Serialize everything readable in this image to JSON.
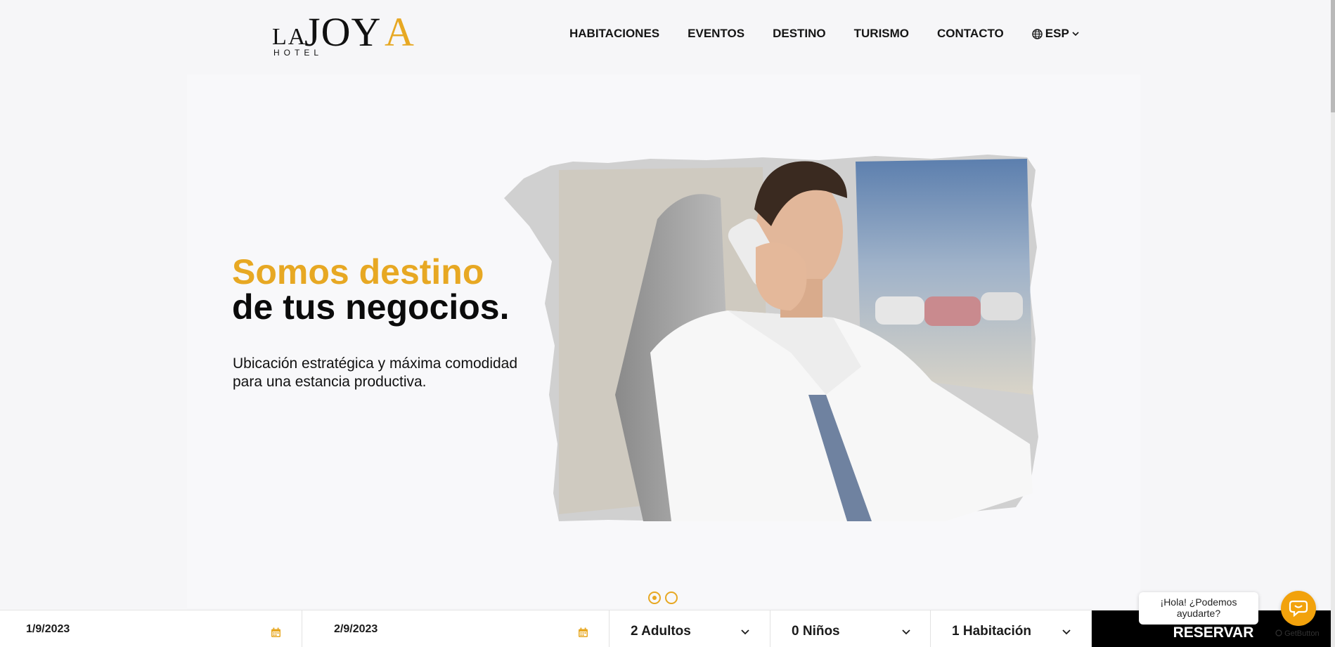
{
  "brand": {
    "logo_la": "LA",
    "logo_joy": "JOY",
    "logo_a": "A",
    "logo_hotel": "HOTEL",
    "accent_color": "#e7a823"
  },
  "nav": {
    "items": [
      "HABITACIONES",
      "EVENTOS",
      "DESTINO",
      "TURISMO",
      "CONTACTO"
    ],
    "language": "ESP",
    "language_icon": "globe-icon"
  },
  "hero": {
    "title_line1": "Somos destino",
    "title_line2": "de tus negocios.",
    "subtitle": "Ubicación estratégica y máxima comodidad para una estancia productiva.",
    "slides": 2,
    "active_slide": 1
  },
  "booking": {
    "checkin": "1/9/2023",
    "checkout": "2/9/2023",
    "adults": "2 Adultos",
    "children": "0 Niños",
    "rooms": "1 Habitación",
    "submit": "RESERVAR"
  },
  "chat": {
    "bubble": "¡Hola! ¿Podemos ayudarte?",
    "credit": "GetButton",
    "button_color": "#f2a20c"
  }
}
